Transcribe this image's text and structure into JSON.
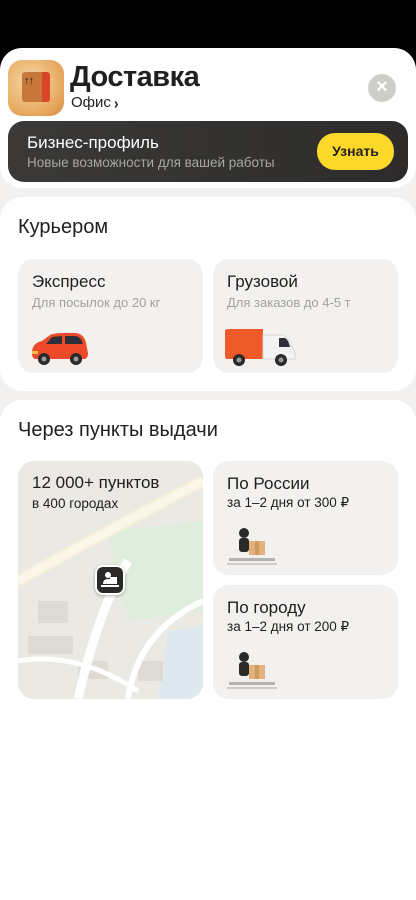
{
  "header": {
    "title": "Доставка",
    "location_label": "Офис",
    "chevron": "›",
    "close_icon": "×",
    "app_icon": "delivery-box-icon"
  },
  "business_banner": {
    "title": "Бизнес-профиль",
    "subtitle": "Новые возможности для вашей работы",
    "button_label": "Узнать",
    "button_color": "#fcd82b"
  },
  "courier": {
    "section_title": "Курьером",
    "options": [
      {
        "title": "Экспресс",
        "subtitle": "Для посылок до 20 кг",
        "icon": "red-car-icon"
      },
      {
        "title": "Грузовой",
        "subtitle": "Для заказов до 4-5 т",
        "icon": "van-icon"
      }
    ]
  },
  "pickup": {
    "section_title": "Через пункты выдачи",
    "map": {
      "title": "12 000+ пунктов",
      "subtitle": "в 400 городах",
      "icon": "pickup-point-pin-icon"
    },
    "options": [
      {
        "title": "По России",
        "subtitle": "за 1–2 дня от 300 ₽",
        "icon": "parcel-courier-icon"
      },
      {
        "title": "По городу",
        "subtitle": "за 1–2 дня от 200 ₽",
        "icon": "parcel-courier-icon"
      }
    ]
  }
}
